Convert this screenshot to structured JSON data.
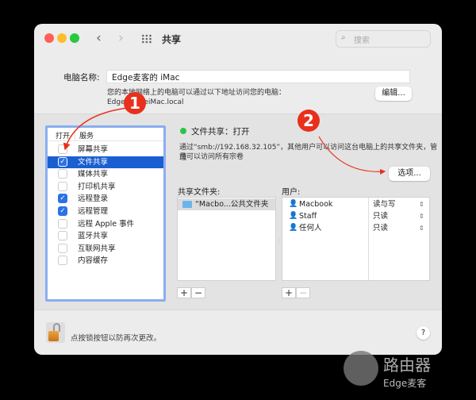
{
  "window": {
    "title": "共享",
    "search_placeholder": "搜索"
  },
  "computer_name": {
    "label": "电脑名称:",
    "value": "Edge麦客的 iMac",
    "help": "您的本地网络上的电脑可以通过以下地址访问您的电脑：",
    "address": "Edge麦客deiMac.local",
    "edit_button": "编辑..."
  },
  "services": {
    "col_on": "打开",
    "col_service": "服务",
    "items": [
      {
        "label": "屏幕共享",
        "checked": false
      },
      {
        "label": "文件共享",
        "checked": true,
        "selected": true
      },
      {
        "label": "媒体共享",
        "checked": false
      },
      {
        "label": "打印机共享",
        "checked": false
      },
      {
        "label": "远程登录",
        "checked": true
      },
      {
        "label": "远程管理",
        "checked": true
      },
      {
        "label": "远程 Apple 事件",
        "checked": false
      },
      {
        "label": "蓝牙共享",
        "checked": false
      },
      {
        "label": "互联网共享",
        "checked": false
      },
      {
        "label": "内容缓存",
        "checked": false
      }
    ]
  },
  "status": {
    "text": "文件共享：打开",
    "color": "#2ec24a",
    "desc1": "通过“smb://192.168.32.105”，其他用户可以访问这台电脑上的共享文件夹，管理",
    "desc2": "员可以访问所有宗卷",
    "options_button": "选项..."
  },
  "shared_folders": {
    "label": "共享文件夹:",
    "items": [
      "“Macbo...公共文件夹"
    ]
  },
  "users": {
    "label": "用户:",
    "items": [
      {
        "name": "Macbook",
        "perm": "读与写"
      },
      {
        "name": "Staff",
        "perm": "只读"
      },
      {
        "name": "任何人",
        "perm": "只读"
      }
    ]
  },
  "controls": {
    "add": "+",
    "remove": "−"
  },
  "footer": {
    "lock_text": "点按锁按钮以防再次更改。",
    "help": "?"
  },
  "annotations": [
    "1",
    "2"
  ],
  "watermark": {
    "line1": "路由器",
    "line2": "Edge麦客"
  }
}
